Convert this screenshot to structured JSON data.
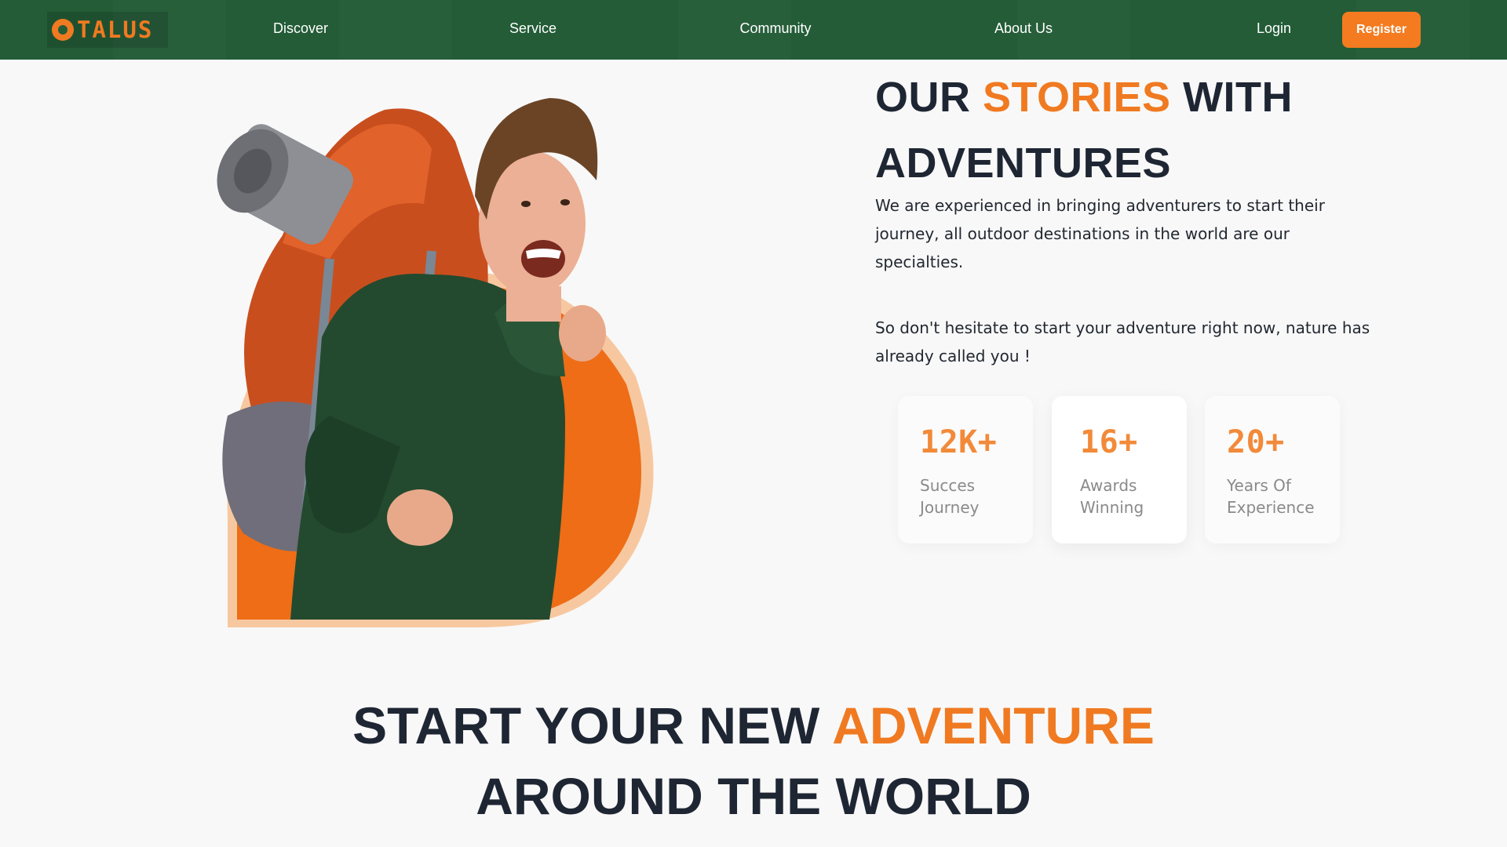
{
  "brand": {
    "name": "TALUS",
    "accent": "#f07a21",
    "nav_bg": "#235c37"
  },
  "nav": {
    "links": [
      "Discover",
      "Service",
      "Community",
      "About Us"
    ],
    "login": "Login",
    "register": "Register"
  },
  "hero": {
    "title_part1": "OUR ",
    "title_accent": "STORIES",
    "title_part2": " WITH ADVENTURES",
    "paragraph1": "We are experienced in bringing adventurers to start their journey, all outdoor destinations in the world are our specialties.",
    "paragraph2": "So don't hesitate to start your adventure right now, nature has already called you !",
    "image_alt": "smiling-hiker-with-backpack"
  },
  "stats": [
    {
      "value": "12K+",
      "label": "Succes Journey"
    },
    {
      "value": "16+",
      "label": "Awards Winning"
    },
    {
      "value": "20+",
      "label": "Years Of Experience"
    }
  ],
  "section2": {
    "title_part1": "START YOUR NEW ",
    "title_accent": "ADVENTURE",
    "title_part2": " AROUND THE WORLD"
  }
}
